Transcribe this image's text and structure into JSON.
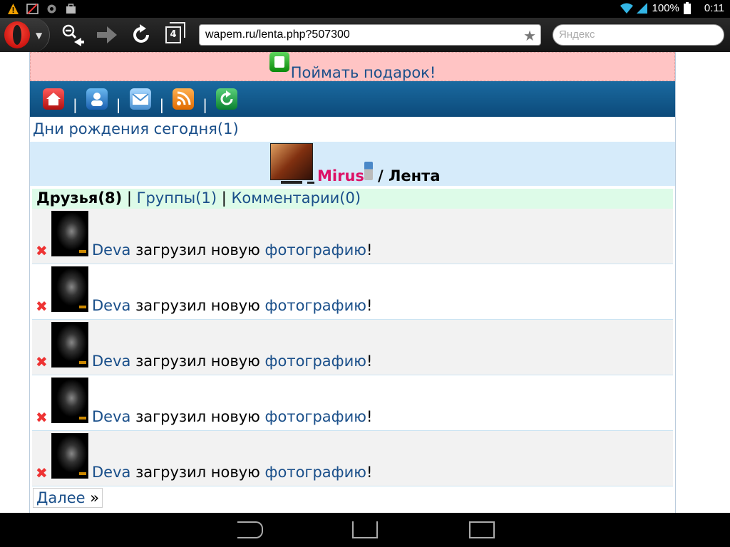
{
  "statusbar": {
    "battery": "100%",
    "time": "0:11"
  },
  "browser": {
    "tab_count": "4",
    "url": "wapem.ru/lenta.php?507300",
    "search_placeholder": "Яндекс"
  },
  "page": {
    "gift_link": "Поймать подарок!",
    "birthdays_link": "Дни рождения сегодня(1)",
    "user": {
      "name": "Mirus",
      "page_title": "/ Лента"
    },
    "tabs": {
      "friends": "Друзья(8)",
      "sep1": "|",
      "groups": "Группы(1)",
      "sep2": "|",
      "comments": "Комментарии(0)"
    },
    "nav_separator": "|",
    "feed": [
      {
        "user": "Deva",
        "action": " загрузил новую ",
        "object": "фотографию",
        "tail": "!"
      },
      {
        "user": "Deva",
        "action": " загрузил новую ",
        "object": "фотографию",
        "tail": "!"
      },
      {
        "user": "Deva",
        "action": " загрузил новую ",
        "object": "фотографию",
        "tail": "!"
      },
      {
        "user": "Deva",
        "action": " загрузил новую ",
        "object": "фотографию",
        "tail": "!"
      },
      {
        "user": "Deva",
        "action": " загрузил новую ",
        "object": "фотографию",
        "tail": "!"
      }
    ],
    "more_label": "Далее",
    "more_arrow": " »"
  },
  "icons": {
    "nav": [
      "home-icon",
      "profile-icon",
      "mail-icon",
      "rss-icon",
      "refresh-icon"
    ],
    "colors": {
      "home": "#d03030",
      "profile": "#2a7ad0",
      "mail": "#5aa0e0",
      "rss": "#f08a20",
      "refresh": "#1a9a3a"
    }
  }
}
